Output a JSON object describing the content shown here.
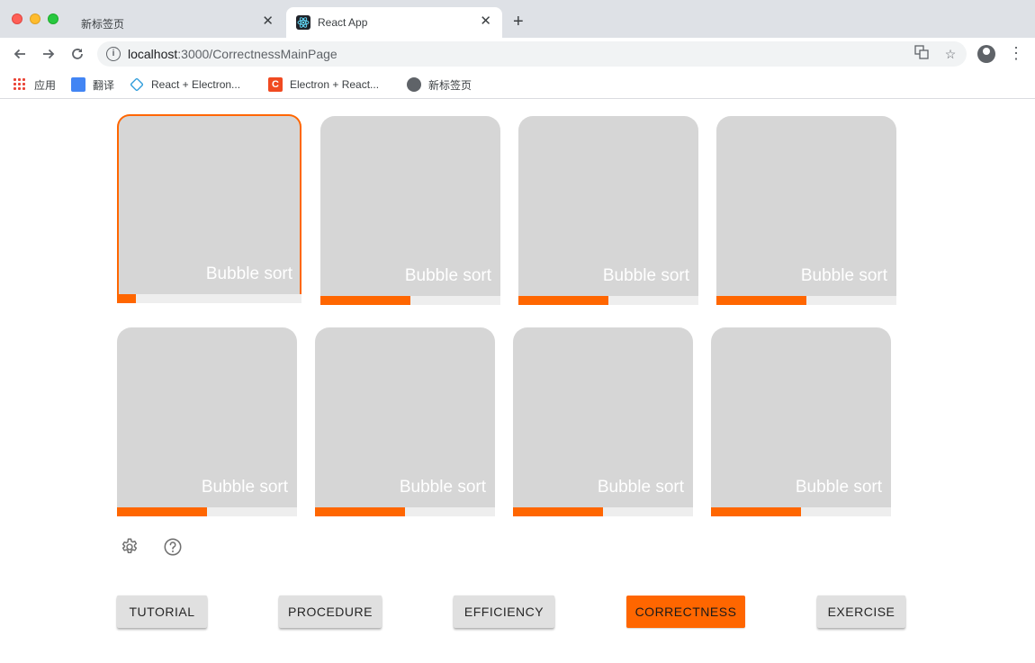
{
  "browser": {
    "tabs": [
      {
        "title": "新标签页",
        "active": false
      },
      {
        "title": "React App",
        "active": true
      }
    ],
    "url_host": "localhost",
    "url_rest": ":3000/CorrectnessMainPage",
    "bookmarks": [
      {
        "label": "应用",
        "icon": "apps-grid-icon"
      },
      {
        "label": "翻译",
        "icon": "translate-icon"
      },
      {
        "label": "React + Electron...",
        "icon": "electron-icon"
      },
      {
        "label": "Electron + React...",
        "icon": "c-logo-icon"
      },
      {
        "label": "新标签页",
        "icon": "globe-icon"
      }
    ]
  },
  "cards": [
    {
      "label": "Bubble sort",
      "progress": 0.1,
      "selected": true
    },
    {
      "label": "Bubble sort",
      "progress": 0.5,
      "selected": false
    },
    {
      "label": "Bubble sort",
      "progress": 0.5,
      "selected": false
    },
    {
      "label": "Bubble sort",
      "progress": 0.5,
      "selected": false
    },
    {
      "label": "Bubble sort",
      "progress": 0.5,
      "selected": false
    },
    {
      "label": "Bubble sort",
      "progress": 0.5,
      "selected": false
    },
    {
      "label": "Bubble sort",
      "progress": 0.5,
      "selected": false
    },
    {
      "label": "Bubble sort",
      "progress": 0.5,
      "selected": false
    }
  ],
  "icons": {
    "settings": "gear-icon",
    "help": "help-circle-icon"
  },
  "nav_buttons": [
    {
      "label": "TUTORIAL",
      "active": false
    },
    {
      "label": "PROCEDURE",
      "active": false
    },
    {
      "label": "EFFICIENCY",
      "active": false
    },
    {
      "label": "CORRECTNESS",
      "active": true
    },
    {
      "label": "EXERCISE",
      "active": false
    }
  ],
  "colors": {
    "accent": "#ff6600",
    "card": "#d6d6d6",
    "track": "#eeeeee",
    "button": "#e0e0e0"
  }
}
